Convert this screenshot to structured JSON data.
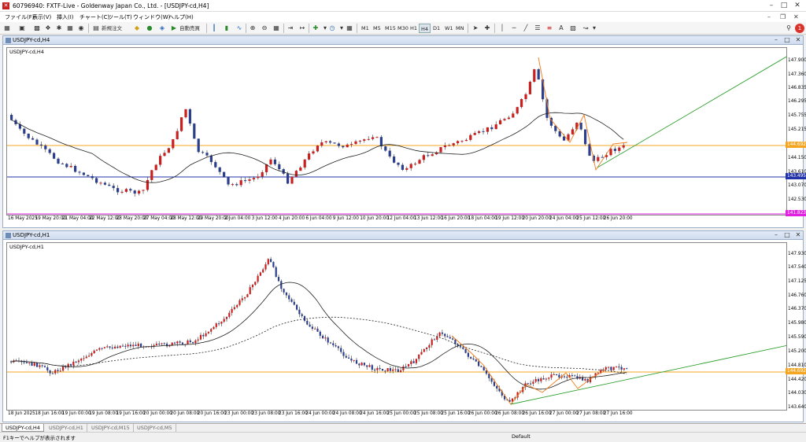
{
  "titlebar": {
    "title": "60796940: FXTF-Live - Goldenway Japan Co., Ltd. - [USDJPY-cd,H4]",
    "min_icon": "minimize-icon",
    "max_icon": "maximize-icon",
    "close_icon": "close-icon"
  },
  "menu": [
    "ファイル(F)",
    "表示(V)",
    "挿入(I)",
    "チャート(C)",
    "ツール(T)",
    "ウィンドウ(W)",
    "ヘルプ(H)"
  ],
  "toolbar": {
    "new_order": "新規注文",
    "auto_trade": "自動売買",
    "timeframes": [
      "M1",
      "M5",
      "M15",
      "M30",
      "H1",
      "H4",
      "D1",
      "W1",
      "MN"
    ],
    "active_timeframe": "H4",
    "text_tool": "A"
  },
  "charts": [
    {
      "window_title": "USDJPY-cd,H4",
      "symbol_label": "USDJPY-cd,H4",
      "y_labels": [
        "147.900",
        "147.360",
        "146.835",
        "146.295",
        "145.755",
        "145.215",
        "144.150",
        "143.610",
        "143.070",
        "142.530"
      ],
      "price_tags": [
        {
          "text": "144.692",
          "color": "#f4a623"
        },
        {
          "text": "143.495",
          "color": "#2233aa"
        },
        {
          "text": "141.823",
          "color": "#e020e0"
        }
      ],
      "x_labels": [
        "16 May 2025",
        "19 May 20:00",
        "21 May 04:00",
        "22 May 12:00",
        "23 May 20:00",
        "27 May 04:00",
        "28 May 12:00",
        "29 May 20:00",
        "2 Jun 04:00",
        "3 Jun 12:00",
        "4 Jun 20:00",
        "6 Jun 04:00",
        "9 Jun 12:00",
        "10 Jun 20:00",
        "12 Jun 04:00",
        "13 Jun 12:00",
        "16 Jun 20:00",
        "18 Jun 04:00",
        "19 Jun 12:00",
        "20 Jun 20:00",
        "24 Jun 04:00",
        "25 Jun 12:00",
        "26 Jun 20:00"
      ]
    },
    {
      "window_title": "USDJPY-cd,H1",
      "symbol_label": "USDJPY-cd,H1",
      "y_labels": [
        "147.930",
        "147.540",
        "147.125",
        "146.760",
        "146.370",
        "145.980",
        "145.590",
        "145.200",
        "144.810",
        "144.420",
        "144.030",
        "143.640"
      ],
      "price_tags": [
        {
          "text": "144.692",
          "color": "#f4a623"
        }
      ],
      "x_labels": [
        "18 Jun 2025",
        "18 Jun 16:00",
        "19 Jun 00:00",
        "19 Jun 08:00",
        "19 Jun 16:00",
        "20 Jun 00:00",
        "20 Jun 08:00",
        "20 Jun 16:00",
        "23 Jun 00:00",
        "23 Jun 08:00",
        "23 Jun 16:00",
        "24 Jun 00:00",
        "24 Jun 08:00",
        "24 Jun 16:00",
        "25 Jun 00:00",
        "25 Jun 08:00",
        "25 Jun 16:00",
        "26 Jun 00:00",
        "26 Jun 08:00",
        "26 Jun 16:00",
        "27 Jun 00:00",
        "27 Jun 08:00",
        "27 Jun 16:00"
      ]
    }
  ],
  "tabs": [
    "USDJPY-cd,H4",
    "USDJPY-cd,H1",
    "USDJPY-cd,M15",
    "USDJPY-cd,M5"
  ],
  "active_tab": "USDJPY-cd,H4",
  "status": {
    "text": "F1キーでヘルプが表示されます",
    "profile": "Default"
  },
  "colors": {
    "bull": "#c8201e",
    "bear": "#2b3f8c",
    "ma": "#222222",
    "trend_orange": "#f07a1a",
    "trend_green": "#2ea02e",
    "hline_orange": "#f4a623",
    "hline_blue": "#2233aa",
    "hline_magenta": "#e020e0",
    "window_frame": "#9bb0c8"
  }
}
